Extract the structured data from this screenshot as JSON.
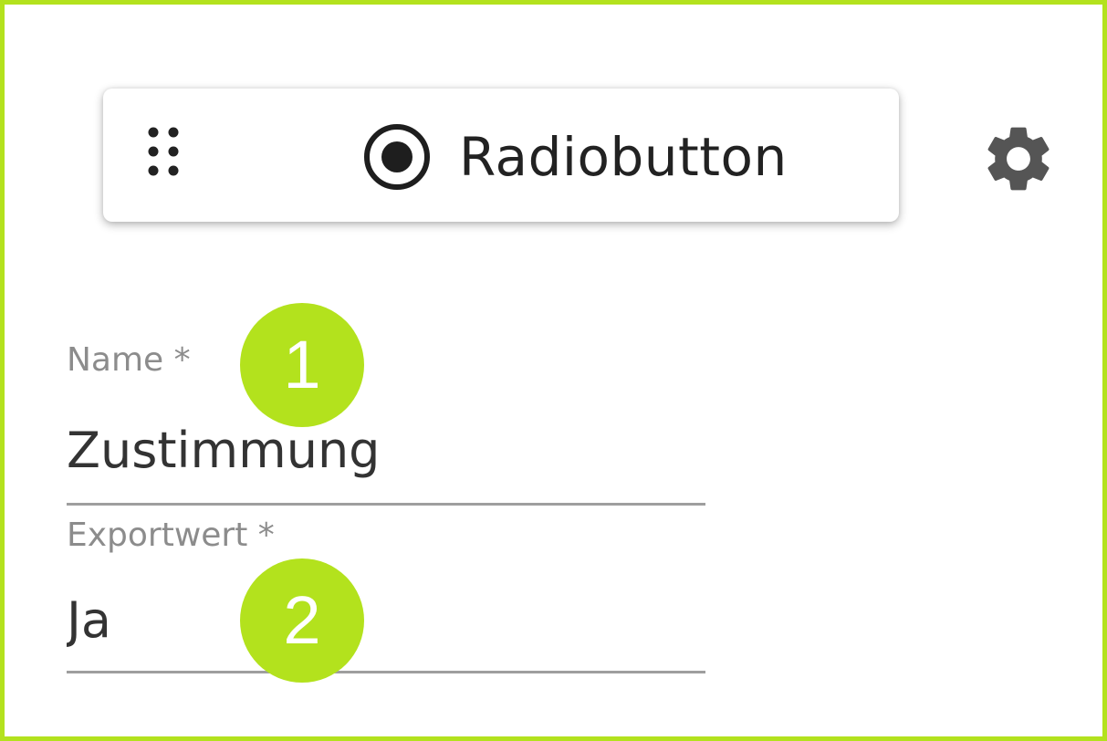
{
  "widget": {
    "label": "Radiobutton",
    "drag_icon": "drag-handle-icon",
    "type_icon": "radio-button-icon"
  },
  "settings": {
    "icon": "gear-icon"
  },
  "fields": {
    "name": {
      "label": "Name *",
      "value": "Zustimmung"
    },
    "export_value": {
      "label": "Exportwert *",
      "value": "Ja"
    }
  },
  "callouts": {
    "first": "1",
    "second": "2"
  },
  "colors": {
    "accent": "#b3e21d",
    "text": "#333333",
    "label": "#8c8c8c",
    "underline": "#9e9e9e",
    "icon": "#555555"
  }
}
